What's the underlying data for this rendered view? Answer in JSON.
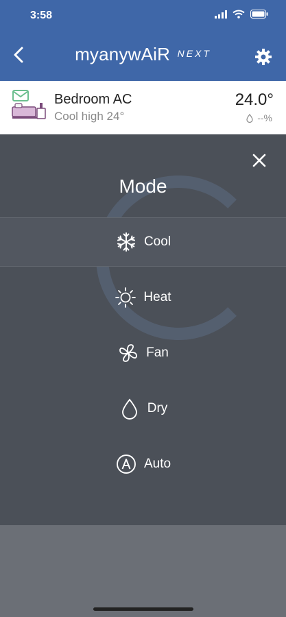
{
  "status": {
    "time": "3:58"
  },
  "header": {
    "brand": "myanywAiR",
    "brand_suffix": "NEXT"
  },
  "device": {
    "name": "Bedroom AC",
    "subtitle": "Cool high 24°",
    "temperature": "24.0°",
    "humidity": "--%"
  },
  "modal": {
    "title": "Mode",
    "items": [
      {
        "label": "Cool",
        "icon": "snowflake-icon",
        "selected": true
      },
      {
        "label": "Heat",
        "icon": "sun-icon",
        "selected": false
      },
      {
        "label": "Fan",
        "icon": "fan-icon",
        "selected": false
      },
      {
        "label": "Dry",
        "icon": "droplet-icon",
        "selected": false
      },
      {
        "label": "Auto",
        "icon": "auto-icon",
        "selected": false
      }
    ]
  },
  "colors": {
    "header": "#3f67a8",
    "overlay": "#4b5058",
    "card": "#ffffff"
  }
}
